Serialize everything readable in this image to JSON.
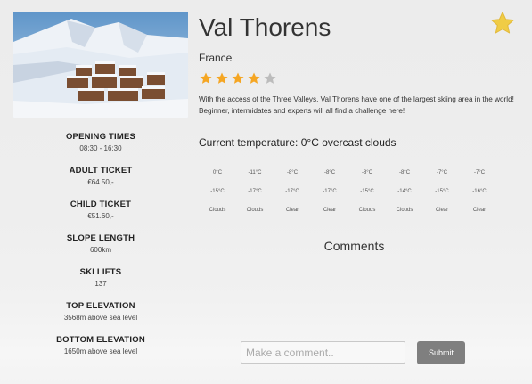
{
  "resort": {
    "name": "Val Thorens",
    "country": "France",
    "rating": 4,
    "max_rating": 5,
    "description": "With the access of the Three Valleys, Val Thorens have one of the largest skiing area in the world! Beginner, intermidates and experts will all find a challenge here!",
    "favorite": true
  },
  "info": [
    {
      "label": "OPENING TIMES",
      "value": "08:30 - 16:30"
    },
    {
      "label": "ADULT TICKET",
      "value": "€64.50,-"
    },
    {
      "label": "CHILD TICKET",
      "value": "€51.60,-"
    },
    {
      "label": "SLOPE LENGTH",
      "value": "600km"
    },
    {
      "label": "SKI LIFTS",
      "value": "137"
    },
    {
      "label": "TOP ELEVATION",
      "value": "3568m above sea level"
    },
    {
      "label": "BOTTOM ELEVATION",
      "value": "1650m above sea level"
    }
  ],
  "weather": {
    "current": "Current temperature: 0°C overcast clouds",
    "forecast": [
      {
        "high": "0°C",
        "low": "-15°C",
        "condition": "Clouds"
      },
      {
        "high": "-11°C",
        "low": "-17°C",
        "condition": "Clouds"
      },
      {
        "high": "-8°C",
        "low": "-17°C",
        "condition": "Clear"
      },
      {
        "high": "-8°C",
        "low": "-17°C",
        "condition": "Clear"
      },
      {
        "high": "-8°C",
        "low": "-15°C",
        "condition": "Clouds"
      },
      {
        "high": "-8°C",
        "low": "-14°C",
        "condition": "Clouds"
      },
      {
        "high": "-7°C",
        "low": "-15°C",
        "condition": "Clear"
      },
      {
        "high": "-7°C",
        "low": "-16°C",
        "condition": "Clear"
      }
    ]
  },
  "comments": {
    "title": "Comments",
    "placeholder": "Make a comment..",
    "submit_label": "Submit"
  },
  "colors": {
    "star_filled": "#f5a623",
    "star_empty": "#bcbcbc",
    "favorite_star": "#f0cc45",
    "submit_button": "#7f7f7f"
  }
}
